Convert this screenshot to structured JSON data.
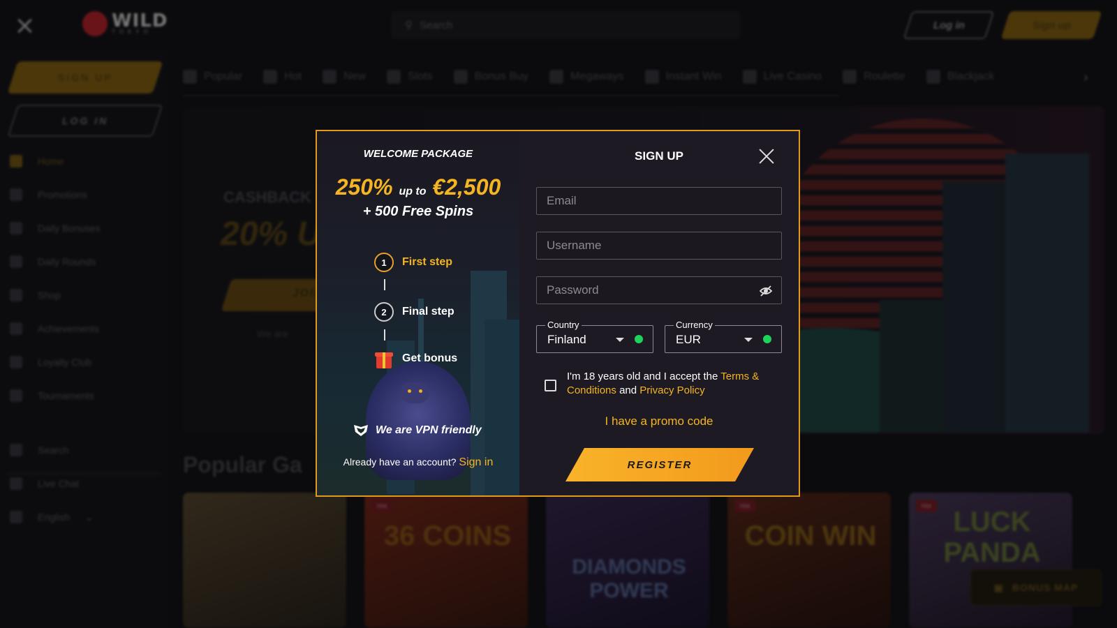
{
  "topbar": {
    "logo_text": "WILD",
    "logo_sub": "TOKYO",
    "search_placeholder": "Search",
    "login_label": "Log in",
    "signup_label": "Sign up"
  },
  "sidebar": {
    "signup_label": "SIGN UP",
    "login_label": "LOG IN",
    "items": [
      {
        "label": "Home",
        "icon": "home-icon"
      },
      {
        "label": "Promotions",
        "icon": "megaphone-icon"
      },
      {
        "label": "Daily Bonuses",
        "icon": "gift-icon"
      },
      {
        "label": "Daily Rounds",
        "icon": "calendar-icon"
      },
      {
        "label": "Shop",
        "icon": "shop-icon"
      },
      {
        "label": "Achievements",
        "icon": "medal-icon"
      },
      {
        "label": "Loyalty Club",
        "icon": "crown-icon"
      },
      {
        "label": "Tournaments",
        "icon": "trophy-icon"
      },
      {
        "label": "Search",
        "icon": "search-icon"
      },
      {
        "label": "Live Chat",
        "icon": "chat-icon"
      },
      {
        "label": "English",
        "icon": "uk-flag-icon"
      }
    ]
  },
  "categories": [
    "Popular",
    "Hot",
    "New",
    "Slots",
    "Bonus Buy",
    "Megaways",
    "Instant Win",
    "Live Casino",
    "Roulette",
    "Blackjack"
  ],
  "banner": {
    "cashback_text": "CASHBACK B",
    "percent_text": "20%",
    "percent_suffix": "U",
    "join_label": "JOIN",
    "vpn_text": "We are"
  },
  "popular_heading": "Popular Ga",
  "games": [
    {
      "title": "",
      "hot": false,
      "color": "#5a4a32"
    },
    {
      "title": "36 COINS",
      "hot": true,
      "badge": "Hot",
      "color": "#7a2a1a"
    },
    {
      "title": "DIAMONDS POWER",
      "hot": false,
      "color": "#3b2a52"
    },
    {
      "title": "COIN WIN",
      "hot": true,
      "badge": "Hot",
      "color": "#5a2a1a"
    },
    {
      "title": "LUCK PANDA",
      "hot": true,
      "badge": "Hot",
      "color": "#4a3a5a"
    }
  ],
  "bonus_map_label": "BONUS MAP",
  "modal": {
    "welcome_title": "WELCOME PACKAGE",
    "amount_pct": "250%",
    "amount_upto": "up to",
    "amount_value": "€2,500",
    "spins": "+ 500 Free Spins",
    "steps": [
      {
        "num": "1",
        "label": "First step"
      },
      {
        "num": "2",
        "label": "Final step"
      },
      {
        "label": "Get bonus"
      }
    ],
    "vpn_text": "We are VPN friendly",
    "have_account": "Already have an account?",
    "sign_in": "Sign in",
    "signup_title": "SIGN UP",
    "email_placeholder": "Email",
    "username_placeholder": "Username",
    "password_placeholder": "Password",
    "country_label": "Country",
    "country_value": "Finland",
    "currency_label": "Currency",
    "currency_value": "EUR",
    "terms_prefix": "I'm 18 years old and I accept the",
    "terms_link": "Terms & Conditions",
    "terms_and": "and",
    "privacy_link": "Privacy Policy",
    "promo_code": "I have a promo code",
    "register_label": "REGISTER"
  },
  "colors": {
    "accent": "#f5b523",
    "modal_border": "#e29a1d",
    "valid_dot": "#1fd25a"
  }
}
